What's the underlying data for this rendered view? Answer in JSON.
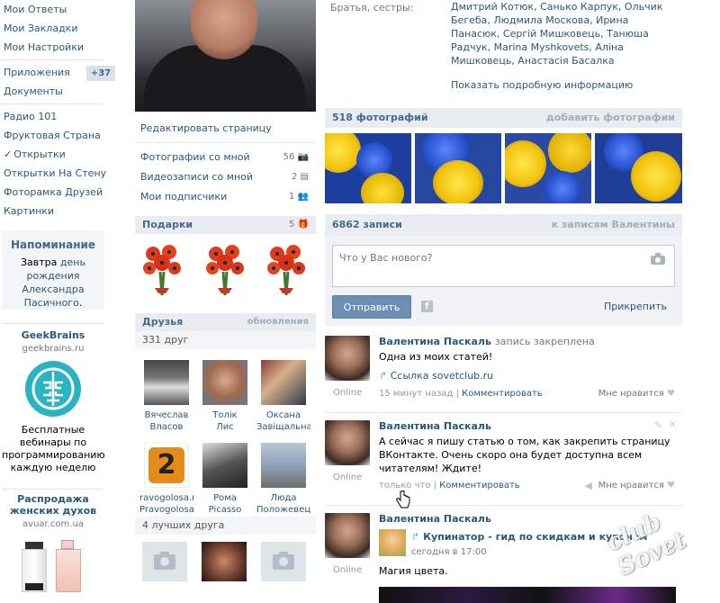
{
  "left_menu": {
    "items_top": [
      "Мои Ответы",
      "Мои Закладки",
      "Мои Настройки"
    ],
    "apps_label": "Приложения",
    "apps_badge": "+37",
    "docs_label": "Документы",
    "items_apps": [
      "Радио 101",
      "Фруктовая Страна",
      "Открытки",
      "Открытки На Стену",
      "Фоторамка Друзей",
      "Картинки"
    ],
    "checked_index": 2
  },
  "reminder": {
    "title": "Напоминание",
    "text_prefix": "Завтра",
    "text_link": "день рождения Александра Пасичного",
    "text_suffix": "."
  },
  "ads": [
    {
      "title": "GeekBrains",
      "domain": "geekbrains.ru",
      "text": "Бесплатные вебинары по программированию каждую неделю"
    },
    {
      "title": "Распродажа женских духов",
      "domain": "avuar.com.ua"
    }
  ],
  "profile_links": {
    "edit": "Редактировать страницу",
    "photos_with_me": "Фотографии со мной",
    "photos_with_me_count": "56",
    "videos_with_me": "Видеозаписи со мной",
    "videos_with_me_count": "2",
    "subscriptions": "Мои подписчики",
    "subscriptions_count": "1"
  },
  "gifts": {
    "title": "Подарки",
    "count": "5"
  },
  "friends": {
    "title": "Друзья",
    "updates": "обновления",
    "count_label": "331 друг",
    "list": [
      {
        "first": "Вячеслав",
        "last": "Власов"
      },
      {
        "first": "Толік",
        "last": "Лис"
      },
      {
        "first": "Оксана",
        "last": "Завіщальна"
      },
      {
        "first": "ravogolosa.ne",
        "last": "Pravogolosaner"
      },
      {
        "first": "Рома",
        "last": "Picasso"
      },
      {
        "first": "Люда",
        "last": "Положевець"
      }
    ],
    "best_label": "4 лучших друга"
  },
  "info": {
    "siblings_label": "Братья, сестры:",
    "siblings": "Дмитрий Котюк, Санько Карпук, Ольчик Бегеба, Людмила Москова, Ирина Панасюк, Сергій Мишковець, Танюша Радчук, Marina Myshkovets, Аліна Мишковець, Анастасія Басалка",
    "show_more": "Показать подробную информацию"
  },
  "photos": {
    "title": "518 фотографий",
    "add": "добавить фотографии"
  },
  "wall": {
    "title": "6862 записи",
    "to_wall": "к записям Валентины",
    "placeholder": "Что у Вас нового?",
    "send": "Отправить",
    "attach": "Прикрепить"
  },
  "posts": [
    {
      "author": "Валентина Паскаль",
      "note": "запись закреплена",
      "text": "Одна из моих статей!",
      "link": "Ссылка sovetclub.ru",
      "time": "15 минут назад",
      "comment": "Комментировать",
      "like": "Мне нравится",
      "online": "Online"
    },
    {
      "author": "Валентина Паскаль",
      "text": "А сейчас я пишу статью о том, как закрепить страницу ВКонтакте. Очень скоро она будет доступна всем читателям! Ждите!",
      "time": "только что",
      "comment": "Комментировать",
      "like": "Мне нравится",
      "online": "Online"
    },
    {
      "author": "Валентина Паскаль",
      "repost_title": "Купинатор - гид по скидкам и купонам",
      "repost_time": "сегодня в 17:00",
      "text": "Магия цвета.",
      "online": "Online"
    }
  ],
  "watermark": "club Sovet"
}
